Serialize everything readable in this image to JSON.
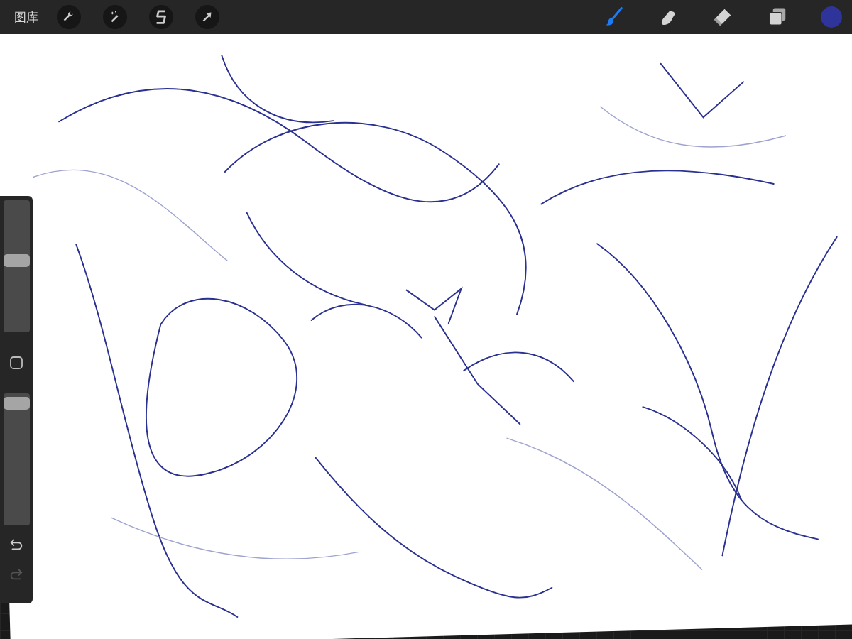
{
  "top_bar": {
    "gallery": "图库",
    "left_tools": [
      {
        "kind": "wrench"
      },
      {
        "kind": "wand"
      },
      {
        "kind": "selection"
      },
      {
        "kind": "arrow"
      }
    ],
    "right_tools": [
      {
        "kind": "brush",
        "selected": true
      },
      {
        "kind": "smudge",
        "selected": false
      },
      {
        "kind": "eraser",
        "selected": false
      },
      {
        "kind": "layers",
        "selected": false
      }
    ],
    "color": "#2e3499"
  },
  "sidebar": {
    "sliders": [
      {
        "level": 0.55
      },
      {
        "level": 0.97
      }
    ],
    "undo": {
      "disabled": false
    },
    "redo": {
      "disabled": true
    }
  }
}
